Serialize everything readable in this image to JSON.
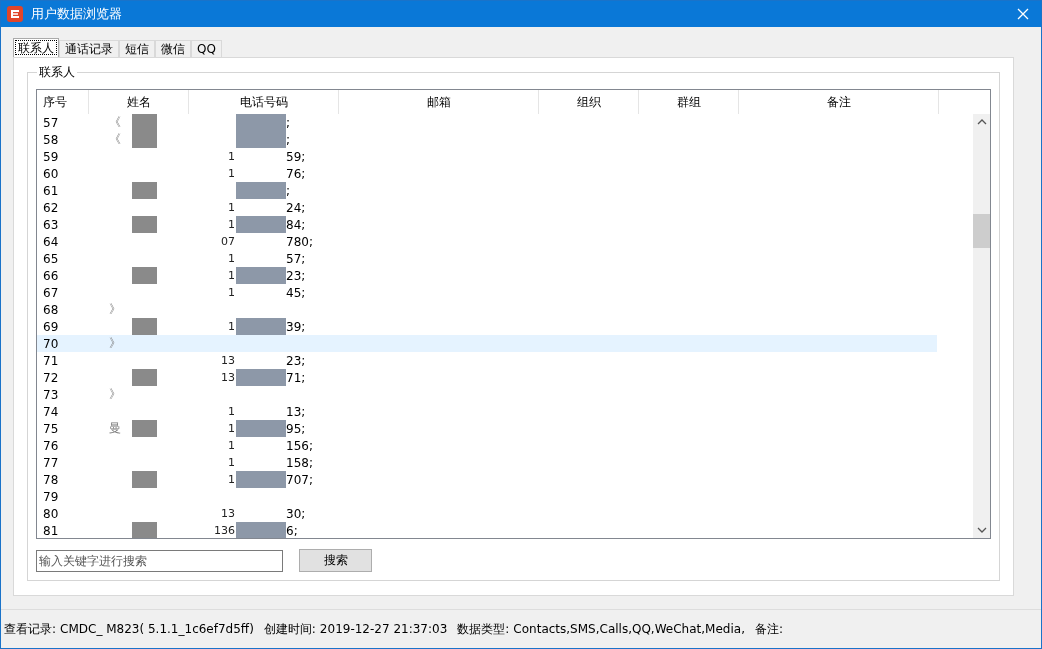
{
  "window": {
    "title": "用户数据浏览器"
  },
  "tabs": [
    {
      "label": "联系人",
      "selected": true
    },
    {
      "label": "通话记录",
      "selected": false
    },
    {
      "label": "短信",
      "selected": false
    },
    {
      "label": "微信",
      "selected": false
    },
    {
      "label": "QQ",
      "selected": false
    }
  ],
  "group_title": "联系人",
  "table": {
    "columns": [
      "序号",
      "姓名",
      "电话号码",
      "邮箱",
      "组织",
      "群组",
      "备注"
    ],
    "rows": [
      {
        "no": "57",
        "name": "《",
        "phone_start": "",
        "phone_end": ";",
        "redacted": true,
        "selected": false
      },
      {
        "no": "58",
        "name": "《",
        "phone_start": "",
        "phone_end": ";",
        "redacted": true,
        "selected": false
      },
      {
        "no": "59",
        "name": "",
        "phone_start": "1",
        "phone_end": "59;",
        "redacted": false,
        "selected": false
      },
      {
        "no": "60",
        "name": "",
        "phone_start": "1",
        "phone_end": "76;",
        "redacted": false,
        "selected": false
      },
      {
        "no": "61",
        "name": "",
        "phone_start": "",
        "phone_end": ";",
        "redacted": true,
        "selected": false
      },
      {
        "no": "62",
        "name": "",
        "phone_start": "1",
        "phone_end": "24;",
        "redacted": false,
        "selected": false
      },
      {
        "no": "63",
        "name": "",
        "phone_start": "1",
        "phone_end": "84;",
        "redacted": true,
        "selected": false
      },
      {
        "no": "64",
        "name": "",
        "phone_start": "07",
        "phone_end": "780;",
        "redacted": false,
        "selected": false
      },
      {
        "no": "65",
        "name": "",
        "phone_start": "1",
        "phone_end": "57;",
        "redacted": false,
        "selected": false
      },
      {
        "no": "66",
        "name": "",
        "phone_start": "1",
        "phone_end": "23;",
        "redacted": true,
        "selected": false
      },
      {
        "no": "67",
        "name": "",
        "phone_start": "1",
        "phone_end": "45;",
        "redacted": false,
        "selected": false
      },
      {
        "no": "68",
        "name": "》",
        "phone_start": "",
        "phone_end": "",
        "redacted": false,
        "selected": false
      },
      {
        "no": "69",
        "name": "",
        "phone_start": "1",
        "phone_end": "39;",
        "redacted": true,
        "selected": false
      },
      {
        "no": "70",
        "name": "》",
        "phone_start": "",
        "phone_end": "",
        "redacted": false,
        "selected": true
      },
      {
        "no": "71",
        "name": "",
        "phone_start": "13",
        "phone_end": "23;",
        "redacted": false,
        "selected": false
      },
      {
        "no": "72",
        "name": "",
        "phone_start": "13",
        "phone_end": "71;",
        "redacted": true,
        "selected": false
      },
      {
        "no": "73",
        "name": "》",
        "phone_start": "",
        "phone_end": "",
        "redacted": false,
        "selected": false
      },
      {
        "no": "74",
        "name": "",
        "phone_start": "1",
        "phone_end": "13;",
        "redacted": false,
        "selected": false
      },
      {
        "no": "75",
        "name": "曼",
        "phone_start": "1",
        "phone_end": "95;",
        "redacted": true,
        "selected": false
      },
      {
        "no": "76",
        "name": "",
        "phone_start": "1",
        "phone_end": "156;",
        "redacted": false,
        "selected": false
      },
      {
        "no": "77",
        "name": "",
        "phone_start": "1",
        "phone_end": "158;",
        "redacted": false,
        "selected": false
      },
      {
        "no": "78",
        "name": "",
        "phone_start": "1",
        "phone_end": "707;",
        "redacted": true,
        "selected": false
      },
      {
        "no": "79",
        "name": "",
        "phone_start": "",
        "phone_end": "",
        "redacted": false,
        "selected": false
      },
      {
        "no": "80",
        "name": "",
        "phone_start": "13",
        "phone_end": "30;",
        "redacted": false,
        "selected": false
      },
      {
        "no": "81",
        "name": "",
        "phone_start": "136",
        "phone_end": "6;",
        "redacted": true,
        "selected": false
      }
    ]
  },
  "search": {
    "placeholder": "输入关键字进行搜索",
    "button": "搜索"
  },
  "status_bar": {
    "record_label": "查看记录:",
    "record": "CMDC_ M823( 5.1.1_1c6ef7d5ff)",
    "created_label": "创建时间:",
    "created": "2019-12-27 21:37:03",
    "types_label": "数据类型:",
    "types": "Contacts,SMS,Calls,QQ,WeChat,Media,",
    "note_label": "备注:"
  }
}
